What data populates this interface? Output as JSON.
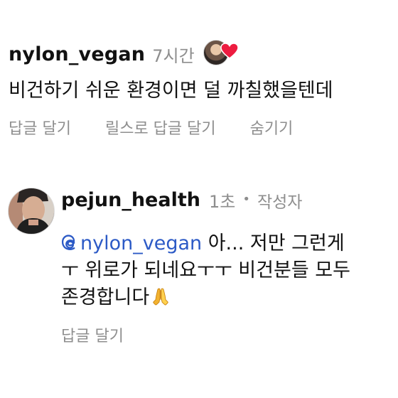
{
  "comment1": {
    "username": "nylon_vegan",
    "time": "7시간",
    "text": "비건하기 쉬운 환경이면 덜 까칠했을텐데",
    "actions": [
      "답글 달기",
      "릴스로 답글 달기",
      "숨기기"
    ]
  },
  "comment2": {
    "username": "pejun_health",
    "time": "1초",
    "separator": "•",
    "author_label": "작성자",
    "mention": "nylon_vegan",
    "line1_rest": " 아... 저만 그런게",
    "line2": "ㅜ 위로가 되네요ㅜㅜ 비건분들 모두",
    "line3": "존경합니다",
    "reply_action": "답글 달기"
  },
  "icons": {
    "creator_like": "heart-icon",
    "mention": "threads-at-icon",
    "emoji": "folded-hands-icon"
  },
  "colors": {
    "username": "#111111",
    "meta": "#8e8e8e",
    "mention": "#2c5ac6",
    "heart": "#ed1c40"
  }
}
